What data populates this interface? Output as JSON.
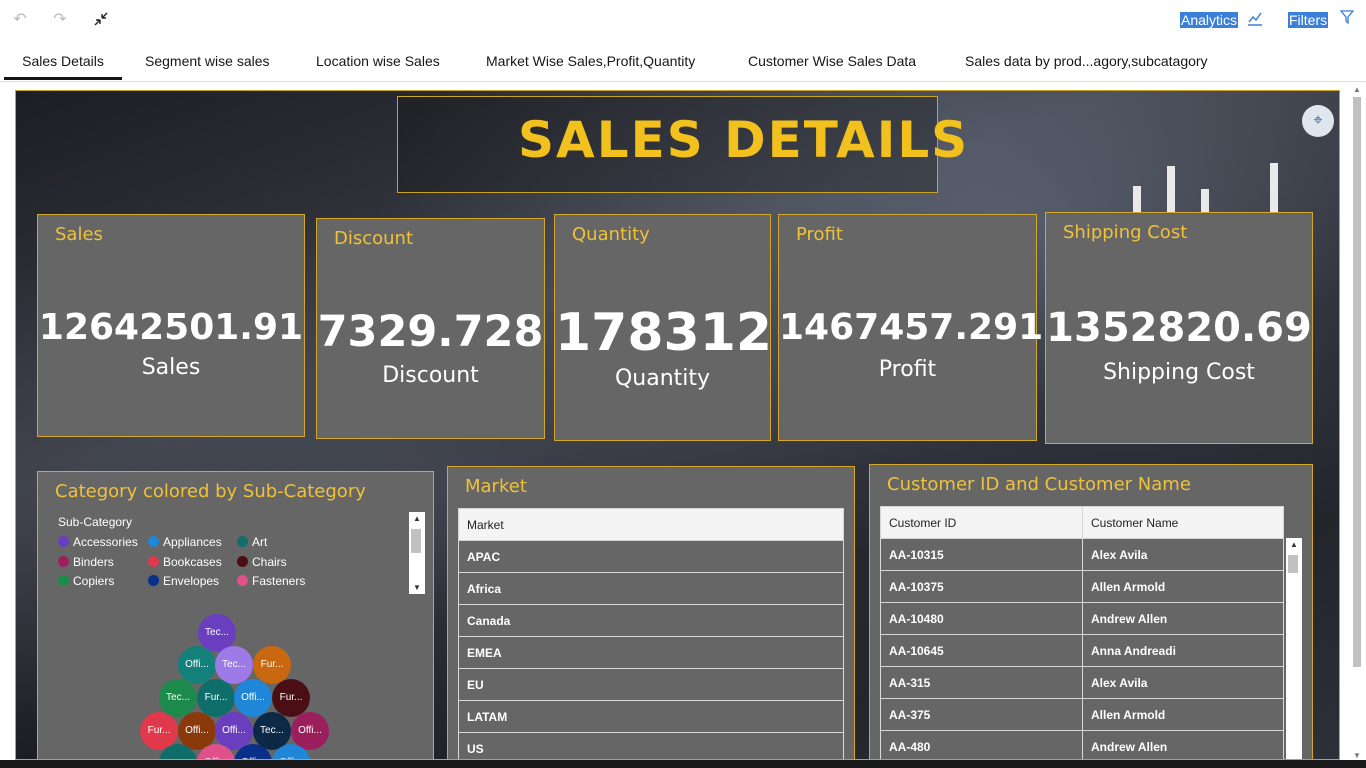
{
  "toolbar": {
    "undo_icon": "undo-icon",
    "redo_icon": "redo-icon",
    "collapse_icon": "collapse-icon",
    "analytics_label": "Analytics",
    "filters_label": "Filters"
  },
  "tabs": [
    {
      "label": "Sales Details",
      "active": true
    },
    {
      "label": "Segment wise sales",
      "active": false
    },
    {
      "label": "Location wise Sales",
      "active": false
    },
    {
      "label": "Market Wise Sales,Profit,Quantity",
      "active": false
    },
    {
      "label": "Customer Wise Sales Data",
      "active": false
    },
    {
      "label": "Sales data by prod...agory,subcatagory",
      "active": false
    }
  ],
  "dashboard": {
    "title": "SALES  DETAILS",
    "accent_color": "#f0c23a"
  },
  "kpis": [
    {
      "title": "Sales",
      "value": "12642501.91",
      "label": "Sales"
    },
    {
      "title": "Discount",
      "value": "7329.728",
      "label": "Discount"
    },
    {
      "title": "Quantity",
      "value": "178312",
      "label": "Quantity"
    },
    {
      "title": "Profit",
      "value": "1467457.291",
      "label": "Profit"
    },
    {
      "title": "Shipping Cost",
      "value": "1352820.69",
      "label": "Shipping Cost"
    }
  ],
  "category_panel": {
    "title": "Category colored by Sub-Category",
    "legend_title": "Sub-Category",
    "legend": [
      {
        "name": "Accessories",
        "color": "#6a3fbf"
      },
      {
        "name": "Appliances",
        "color": "#1f86d8"
      },
      {
        "name": "Art",
        "color": "#0f6e6a"
      },
      {
        "name": "Binders",
        "color": "#9b1f5c"
      },
      {
        "name": "Bookcases",
        "color": "#e0394c"
      },
      {
        "name": "Chairs",
        "color": "#4a0f14"
      },
      {
        "name": "Copiers",
        "color": "#1c8a4a"
      },
      {
        "name": "Envelopes",
        "color": "#0a2f8a"
      },
      {
        "name": "Fasteners",
        "color": "#e0508a"
      }
    ],
    "bubbles": [
      {
        "label": "Tec...",
        "color": "#6a3fbf"
      },
      {
        "label": "Offi...",
        "color": "#13807a"
      },
      {
        "label": "Tec...",
        "color": "#9d7ae8"
      },
      {
        "label": "Fur...",
        "color": "#c9680e"
      },
      {
        "label": "Tec...",
        "color": "#1c8a4a"
      },
      {
        "label": "Fur...",
        "color": "#0f6e6a"
      },
      {
        "label": "Offi...",
        "color": "#1f86d8"
      },
      {
        "label": "Fur...",
        "color": "#4a0f14"
      },
      {
        "label": "Fur...",
        "color": "#e0394c"
      },
      {
        "label": "Offi...",
        "color": "#8a3a0a"
      },
      {
        "label": "Offi...",
        "color": "#6a3fbf"
      },
      {
        "label": "Tec...",
        "color": "#0c2a48"
      },
      {
        "label": "Offi...",
        "color": "#9b1f5c"
      },
      {
        "label": "",
        "color": "#0f6e6a"
      },
      {
        "label": "Offi...",
        "color": "#e0508a"
      },
      {
        "label": "Offi...",
        "color": "#0a2f8a"
      },
      {
        "label": "Offi...",
        "color": "#1f86d8"
      }
    ]
  },
  "market_panel": {
    "title": "Market",
    "column": "Market",
    "rows": [
      "APAC",
      "Africa",
      "Canada",
      "EMEA",
      "EU",
      "LATAM",
      "US"
    ]
  },
  "customer_panel": {
    "title": "Customer ID and Customer Name",
    "columns": [
      "Customer ID",
      "Customer Name"
    ],
    "rows": [
      [
        "AA-10315",
        "Alex Avila"
      ],
      [
        "AA-10375",
        "Allen Armold"
      ],
      [
        "AA-10480",
        "Andrew Allen"
      ],
      [
        "AA-10645",
        "Anna Andreadi"
      ],
      [
        "AA-315",
        "Alex Avila"
      ],
      [
        "AA-375",
        "Allen Armold"
      ],
      [
        "AA-480",
        "Andrew Allen"
      ]
    ]
  }
}
